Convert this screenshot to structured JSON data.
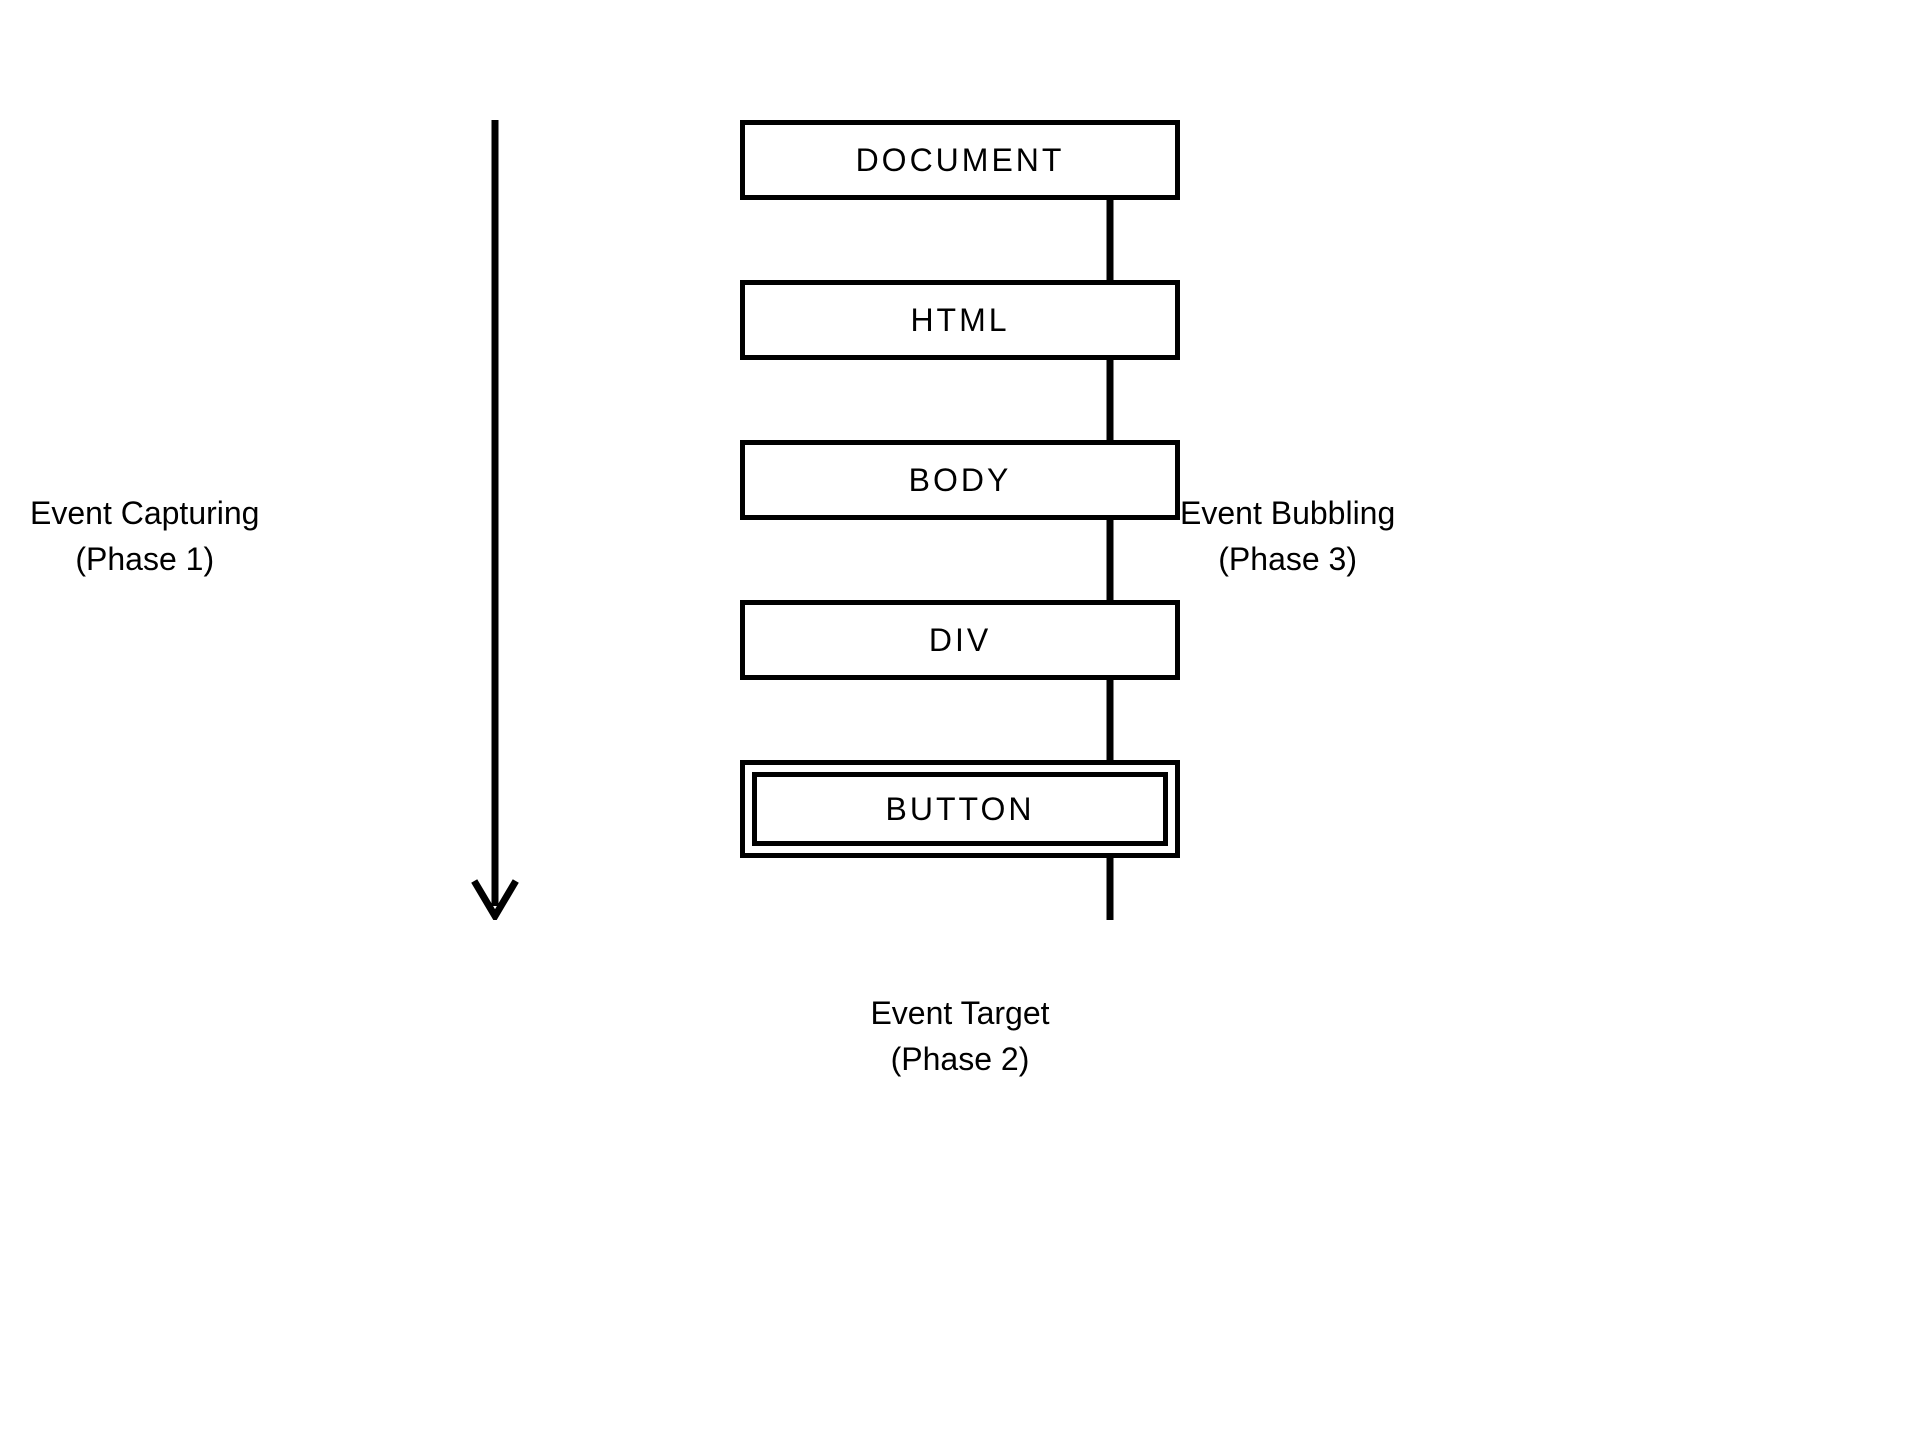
{
  "boxes": {
    "0": "DOCUMENT",
    "1": "HTML",
    "2": "BODY",
    "3": "DIV",
    "target": "BUTTON"
  },
  "labels": {
    "capturing": {
      "line1": "Event Capturing",
      "line2": "(Phase 1)"
    },
    "target": {
      "line1": "Event Target",
      "line2": "(Phase 2)"
    },
    "bubbling": {
      "line1": "Event Bubbling",
      "line2": "(Phase 3)"
    }
  }
}
